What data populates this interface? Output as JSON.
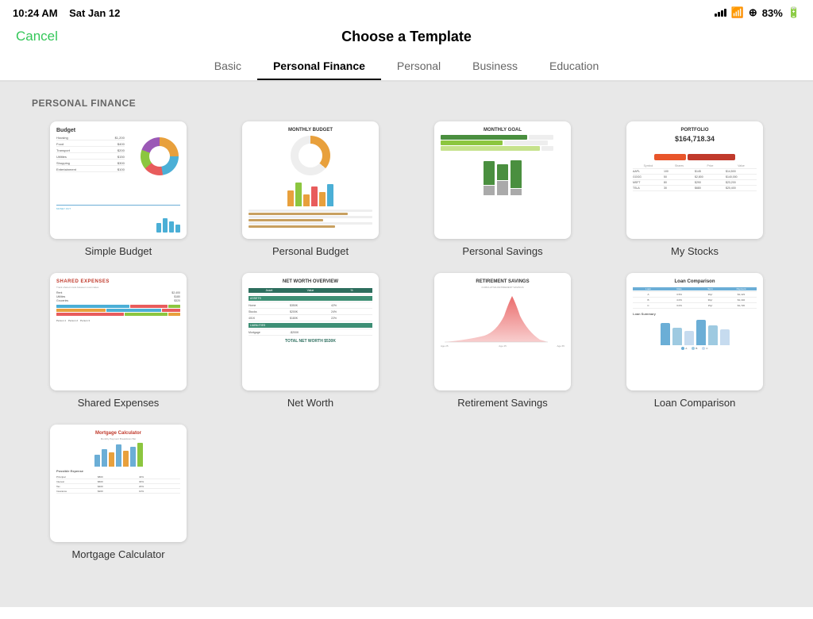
{
  "statusBar": {
    "time": "10:24 AM",
    "date": "Sat Jan 12",
    "battery": "83%"
  },
  "header": {
    "cancel": "Cancel",
    "title": "Choose a Template"
  },
  "tabs": [
    {
      "id": "basic",
      "label": "Basic",
      "active": false
    },
    {
      "id": "personal-finance",
      "label": "Personal Finance",
      "active": true
    },
    {
      "id": "personal",
      "label": "Personal",
      "active": false
    },
    {
      "id": "business",
      "label": "Business",
      "active": false
    },
    {
      "id": "education",
      "label": "Education",
      "active": false
    }
  ],
  "section": {
    "title": "PERSONAL FINANCE"
  },
  "templates": [
    {
      "id": "simple-budget",
      "label": "Simple Budget"
    },
    {
      "id": "personal-budget",
      "label": "Personal Budget"
    },
    {
      "id": "personal-savings",
      "label": "Personal Savings"
    },
    {
      "id": "my-stocks",
      "label": "My Stocks"
    },
    {
      "id": "shared-expenses",
      "label": "Shared Expenses"
    },
    {
      "id": "net-worth",
      "label": "Net Worth"
    },
    {
      "id": "retirement-savings",
      "label": "Retirement Savings"
    },
    {
      "id": "loan-comparison",
      "label": "Loan Comparison"
    },
    {
      "id": "mortgage-calculator",
      "label": "Mortgage Calculator"
    }
  ]
}
